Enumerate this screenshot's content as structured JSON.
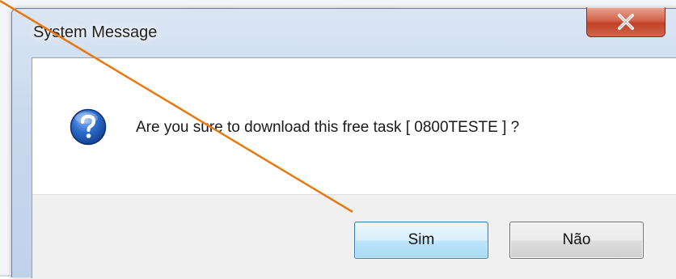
{
  "dialog": {
    "title": "System Message",
    "message": "Are you sure to download this free task [ 0800TESTE ] ?",
    "icon": "question-icon",
    "close_icon": "close-icon"
  },
  "buttons": {
    "yes_label": "Sim",
    "no_label": "Não"
  },
  "colors": {
    "annotation": "#e8780f",
    "default_button_border": "#3c7fb1",
    "close_button": "#c14128",
    "question_icon": "#1f56b8"
  }
}
